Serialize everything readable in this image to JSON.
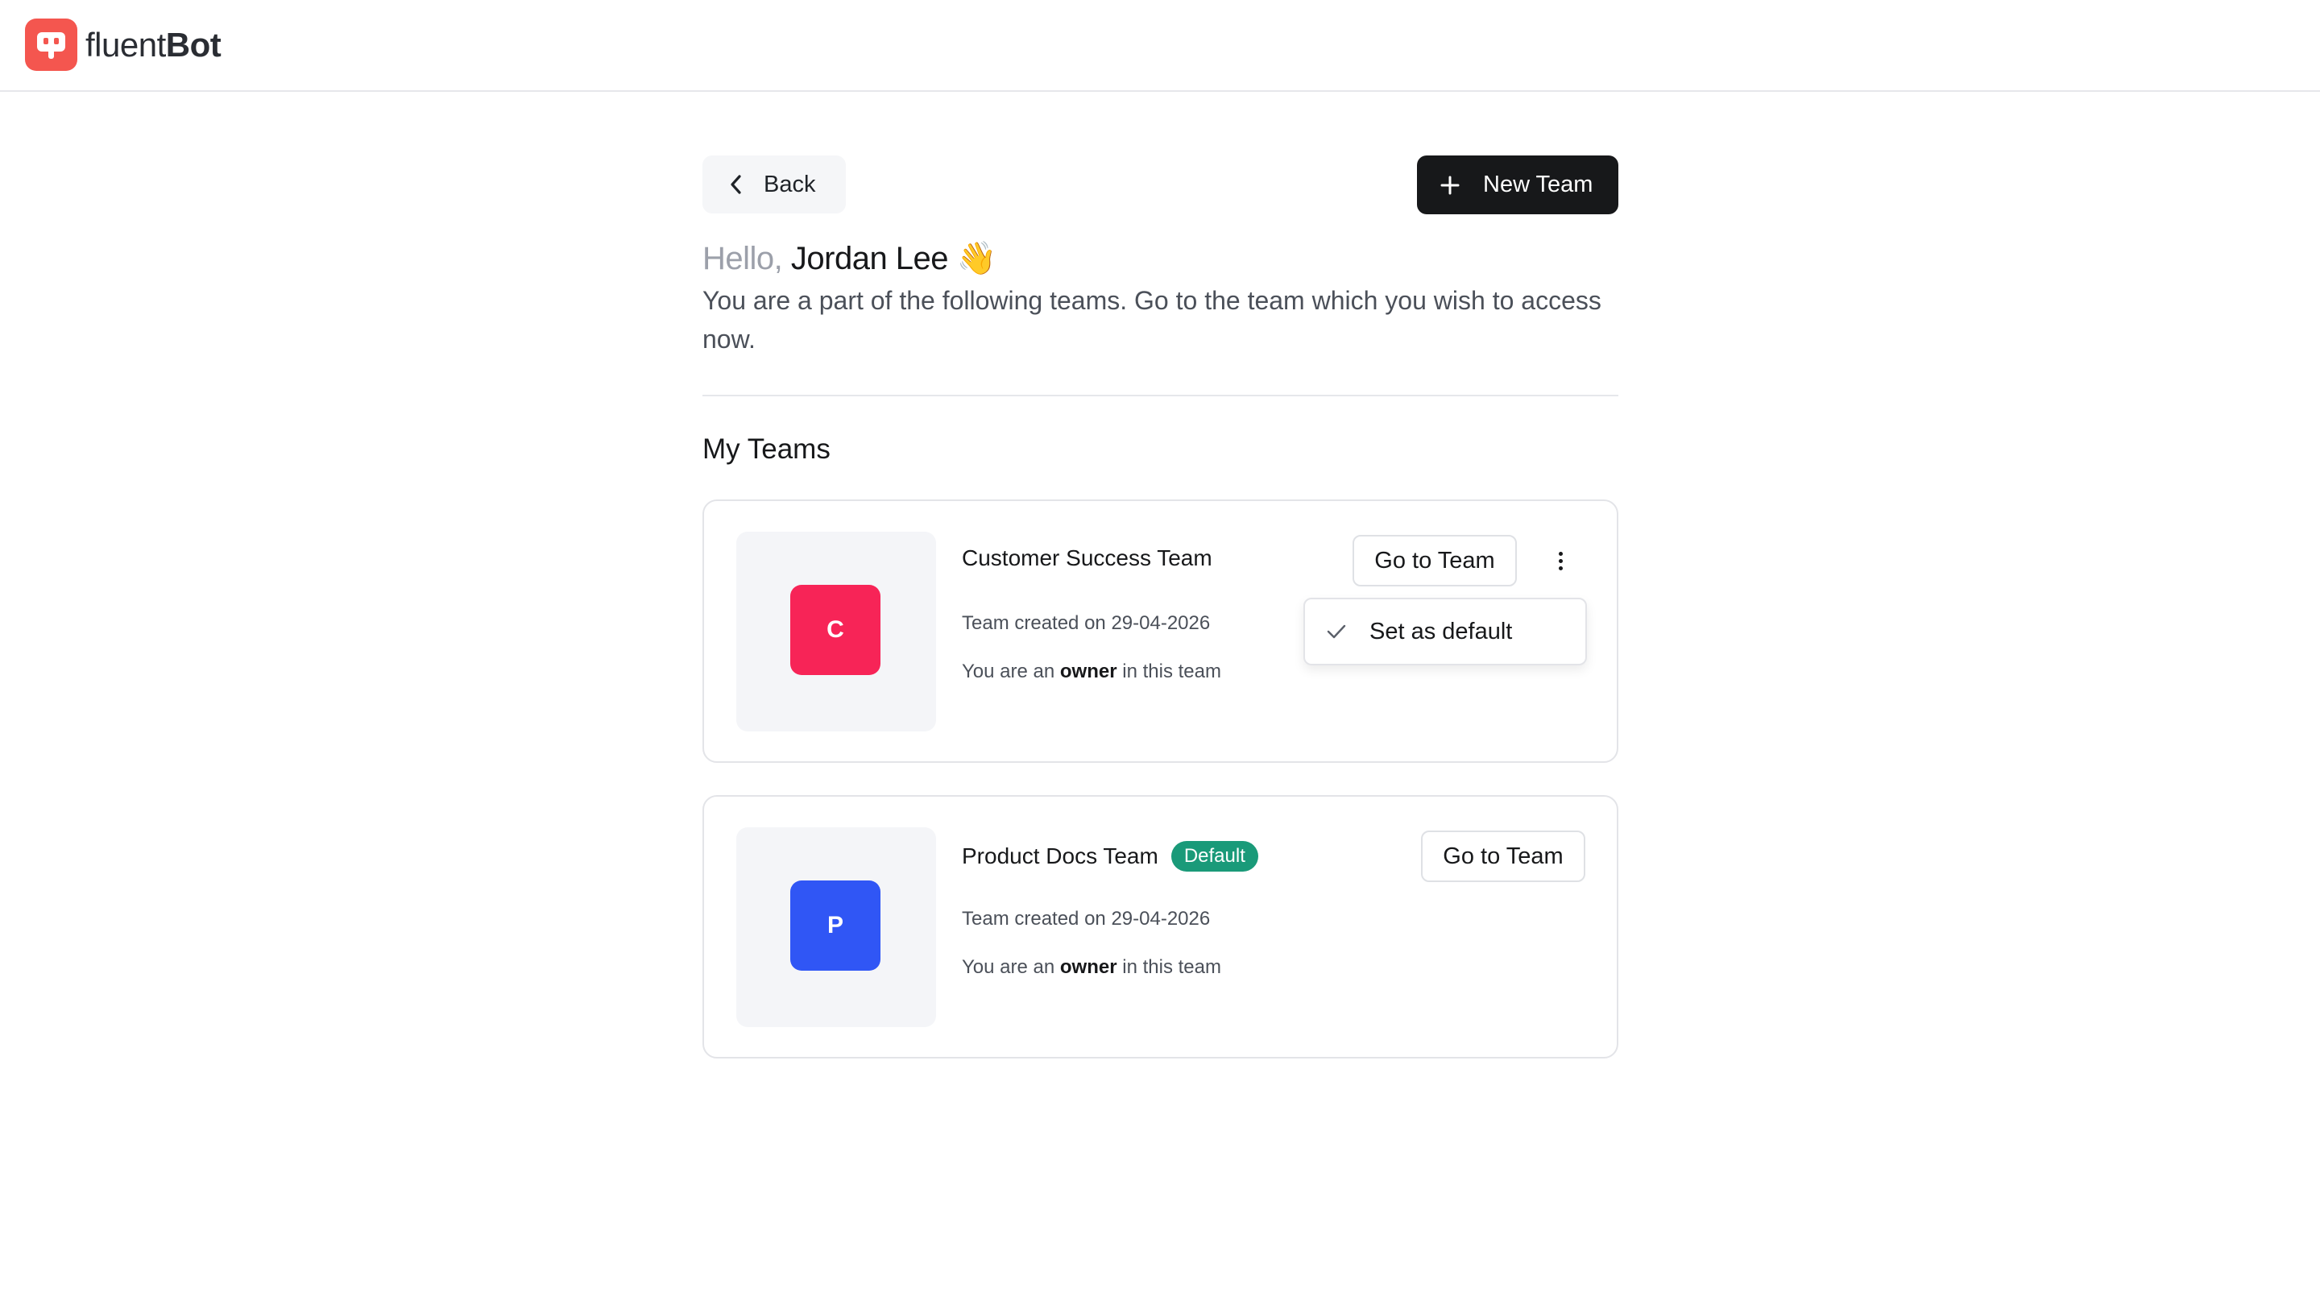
{
  "brand": {
    "name_light": "fluent",
    "name_bold": "Bot",
    "logo_icon": "chat-bot-icon"
  },
  "header": {
    "back_label": "Back",
    "new_team_label": "New Team"
  },
  "greeting": {
    "hello": "Hello,",
    "name": "Jordan Lee",
    "emoji": "👋",
    "subtitle": "You are a part of the following teams. Go to the team which you wish to access now."
  },
  "section": {
    "title": "My Teams"
  },
  "teams": [
    {
      "initial": "C",
      "name": "Customer Success Team",
      "created": "Team created on 29-04-2026",
      "role_prefix": "You are an",
      "role": "owner",
      "role_suffix": "in this team",
      "go_label": "Go to Team",
      "avatar_color": "#f72457",
      "is_default": false,
      "menu": {
        "open": true,
        "items": [
          {
            "label": "Set as default",
            "icon": "check-icon"
          }
        ]
      }
    },
    {
      "initial": "P",
      "name": "Product Docs Team",
      "badge": "Default",
      "created": "Team created on 29-04-2026",
      "role_prefix": "You are an",
      "role": "owner",
      "role_suffix": "in this team",
      "go_label": "Go to Team",
      "avatar_color": "#3056f5",
      "is_default": true
    }
  ],
  "colors": {
    "accent_dark": "#17181a",
    "brand_red": "#f4564f",
    "default_badge": "#1a9a79"
  }
}
